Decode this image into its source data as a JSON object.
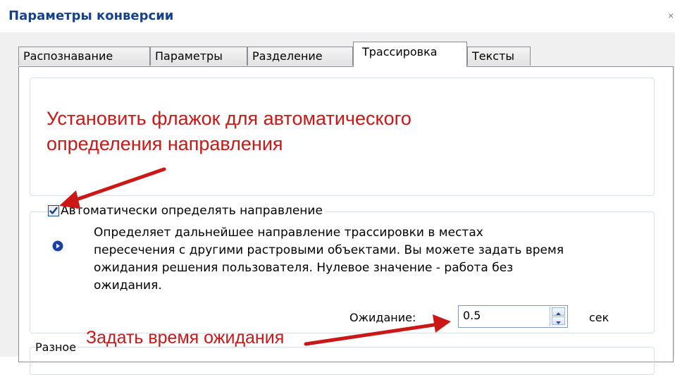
{
  "window": {
    "title": "Параметры конверсии",
    "close_glyph": "×"
  },
  "tabs": [
    {
      "label": "Распознавание",
      "active": false
    },
    {
      "label": "Параметры",
      "active": false
    },
    {
      "label": "Разделение",
      "active": false
    },
    {
      "label": "Трассировка",
      "active": true
    },
    {
      "label": "Тексты",
      "active": false
    }
  ],
  "annotations": {
    "instruction_line1": "Установить флажок для автоматического",
    "instruction_line2": "определения направления",
    "wait_instruction": "Задать время ожидания",
    "color": "#cc1717"
  },
  "auto_direction": {
    "checkbox_label": "Автоматически определять направление",
    "checked": true,
    "description_lines": [
      "Определяет дальнейшее направление трассировки в местах",
      "пересечения с другими растровыми объектами. Вы можете задать время",
      "ожидания решения пользователя. Нулевое значение - работа без",
      "ожидания."
    ],
    "wait_label": "Ожидание:",
    "wait_value": "0.5",
    "wait_unit": "сек",
    "info_icon": "info-icon"
  },
  "misc_group": {
    "label": "Разное"
  },
  "colors": {
    "title": "#15428b",
    "dialog_bg": "#f0f0f0",
    "check_blue": "#1c4a8c"
  }
}
